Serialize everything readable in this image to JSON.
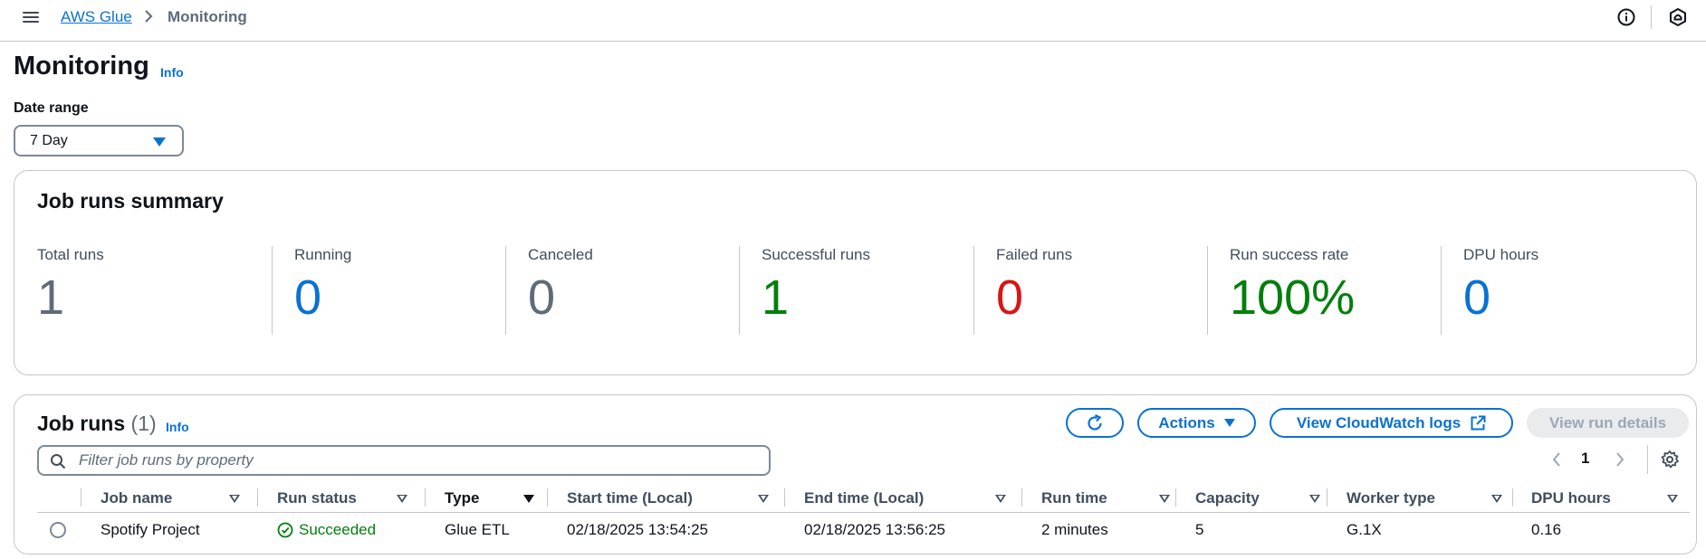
{
  "breadcrumb": {
    "service": "AWS Glue",
    "current": "Monitoring"
  },
  "header": {
    "title": "Monitoring",
    "info": "Info"
  },
  "date_range": {
    "label": "Date range",
    "value": "7 Day"
  },
  "summary": {
    "title": "Job runs summary",
    "metrics": [
      {
        "label": "Total runs",
        "value": "1",
        "color": "#5f6b7a"
      },
      {
        "label": "Running",
        "value": "0",
        "color": "#0972d3"
      },
      {
        "label": "Canceled",
        "value": "0",
        "color": "#5f6b7a"
      },
      {
        "label": "Successful runs",
        "value": "1",
        "color": "#037f0c"
      },
      {
        "label": "Failed runs",
        "value": "0",
        "color": "#d91515"
      },
      {
        "label": "Run success rate",
        "value": "100%",
        "color": "#037f0c"
      },
      {
        "label": "DPU hours",
        "value": "0",
        "color": "#0972d3"
      }
    ]
  },
  "job_runs": {
    "title": "Job runs",
    "count": "(1)",
    "info": "Info",
    "actions_label": "Actions",
    "cloudwatch_label": "View CloudWatch logs",
    "view_details_label": "View run details",
    "search_placeholder": "Filter job runs by property",
    "page": "1",
    "columns": [
      "Job name",
      "Run status",
      "Type",
      "Start time (Local)",
      "End time (Local)",
      "Run time",
      "Capacity",
      "Worker type",
      "DPU hours"
    ],
    "rows": [
      {
        "job_name": "Spotify Project",
        "run_status": "Succeeded",
        "type": "Glue ETL",
        "start_time": "02/18/2025 13:54:25",
        "end_time": "02/18/2025 13:56:25",
        "run_time": "2 minutes",
        "capacity": "5",
        "worker_type": "G.1X",
        "dpu_hours": "0.16"
      }
    ]
  },
  "colors": {
    "link": "#0972d3",
    "success": "#037f0c",
    "error": "#d91515"
  },
  "icons": [
    "menu-icon",
    "chevron-right-icon",
    "info-circle-icon",
    "notifications-icon",
    "refresh-icon",
    "caret-down-icon",
    "external-link-icon",
    "search-icon",
    "chevron-left-icon",
    "settings-icon",
    "success-check-icon"
  ]
}
